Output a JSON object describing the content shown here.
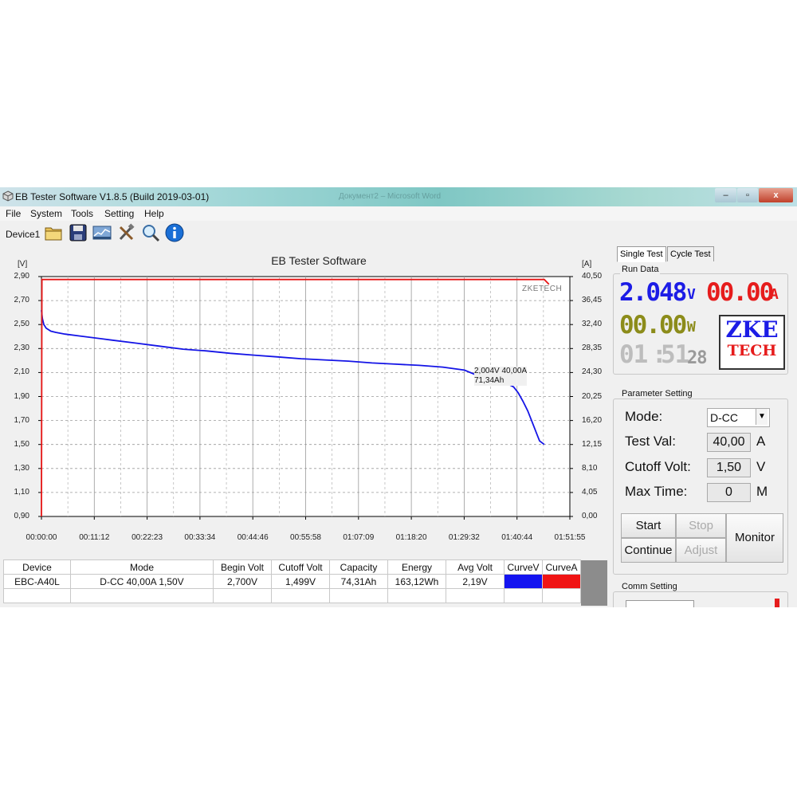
{
  "window": {
    "title": "EB Tester Software V1.8.5 (Build 2019-03-01)",
    "background_title": "Документ2 – Microsoft Word",
    "controls": {
      "minimize": "–",
      "maximize": "▫",
      "close": "x"
    }
  },
  "menu": [
    "File",
    "System",
    "Tools",
    "Setting",
    "Help"
  ],
  "toolbar": {
    "device": "Device1",
    "icons": [
      "open-folder-icon",
      "save-icon",
      "chart-icon",
      "tools-icon",
      "search-icon",
      "info-icon"
    ]
  },
  "chart_data": {
    "type": "line",
    "title": "EB Tester Software",
    "y_left_unit": "[V]",
    "y_right_unit": "[A]",
    "y_left_ticks": [
      "2,90",
      "2,70",
      "2,50",
      "2,30",
      "2,10",
      "1,90",
      "1,70",
      "1,50",
      "1,30",
      "1,10",
      "0,90"
    ],
    "y_right_ticks": [
      "40,50",
      "36,45",
      "32,40",
      "28,35",
      "24,30",
      "20,25",
      "16,20",
      "12,15",
      "8,10",
      "4,05",
      "0,00"
    ],
    "x_ticks": [
      "00:00:00",
      "00:11:12",
      "00:22:23",
      "00:33:34",
      "00:44:46",
      "00:55:58",
      "01:07:09",
      "01:18:20",
      "01:29:32",
      "01:40:44",
      "01:51:55"
    ],
    "x_range_min": [
      0,
      111.92
    ],
    "y_left_range": [
      0.9,
      2.9
    ],
    "y_right_range": [
      0.0,
      40.5
    ],
    "grid": true,
    "watermark": "ZKETECH",
    "annotation": {
      "line1": "2,004V  40,00A",
      "line2": "71,34Ah"
    },
    "series": [
      {
        "name": "CurveV",
        "axis": "left",
        "color": "#1414e6",
        "x_min": [
          0,
          0.2,
          0.5,
          1,
          2,
          3,
          5,
          8,
          10,
          15,
          20,
          25,
          30,
          35,
          40,
          45,
          50,
          55,
          60,
          65,
          70,
          75,
          80,
          85,
          89.6,
          95.1,
          97,
          99,
          100,
          101,
          102,
          103,
          104,
          105,
          105.5,
          106.5
        ],
        "values": [
          2.62,
          2.55,
          2.5,
          2.47,
          2.445,
          2.435,
          2.42,
          2.405,
          2.395,
          2.37,
          2.345,
          2.32,
          2.295,
          2.28,
          2.26,
          2.245,
          2.23,
          2.215,
          2.205,
          2.195,
          2.18,
          2.17,
          2.16,
          2.145,
          2.12,
          2.03,
          2.02,
          2.0,
          1.98,
          1.93,
          1.86,
          1.78,
          1.68,
          1.58,
          1.53,
          1.5
        ]
      },
      {
        "name": "CurveA",
        "axis": "right",
        "color": "#e61414",
        "x_min": [
          0,
          0.1,
          0.2,
          106.5,
          107.5
        ],
        "values": [
          0,
          40.0,
          40.0,
          40.0,
          39.2
        ]
      }
    ]
  },
  "table": {
    "headers": [
      "Device",
      "Mode",
      "Begin Volt",
      "Cutoff Volt",
      "Capacity",
      "Energy",
      "Avg Volt",
      "CurveV",
      "CurveA"
    ],
    "rows": [
      [
        "EBC-A40L",
        "D-CC  40,00A  1,50V",
        "2,700V",
        "1,499V",
        "74,31Ah",
        "163,12Wh",
        "2,19V",
        "",
        ""
      ]
    ],
    "swatch_colors": {
      "CurveV": "#1414f0",
      "CurveA": "#f01414"
    }
  },
  "panel": {
    "tabs": [
      "Single Test",
      "Cycle Test"
    ],
    "run_data": {
      "title": "Run Data",
      "voltage": "2.048",
      "voltage_unit": "V",
      "current": "00.00",
      "current_unit": "A",
      "power": "00.00",
      "power_unit": "W",
      "time_hours": "01",
      "time_minutes": "51",
      "time_seconds": "28",
      "logo_top": "ZKE",
      "logo_bottom": "TECH"
    },
    "parameter_setting": {
      "title": "Parameter Setting",
      "mode_label": "Mode:",
      "mode_value": "D-CC",
      "test_val_label": "Test Val:",
      "test_val": "40,00",
      "test_val_unit": "A",
      "cutoff_label": "Cutoff Volt:",
      "cutoff_val": "1,50",
      "cutoff_unit": "V",
      "max_time_label": "Max Time:",
      "max_time_val": "0",
      "max_time_unit": "M"
    },
    "buttons": {
      "start": "Start",
      "stop": "Stop",
      "continue": "Continue",
      "adjust": "Adjust",
      "monitor": "Monitor"
    },
    "comm_setting": {
      "title": "Comm Setting"
    }
  }
}
